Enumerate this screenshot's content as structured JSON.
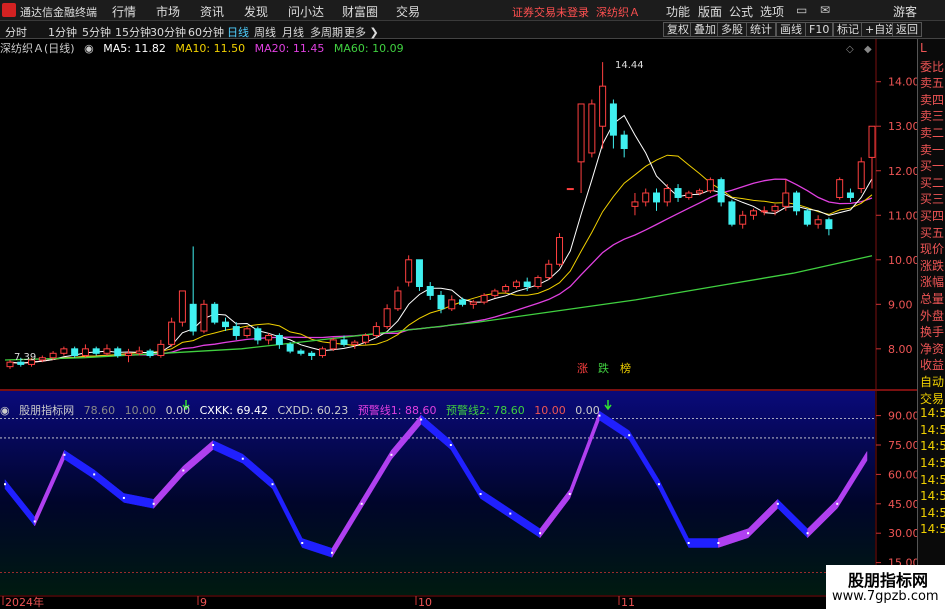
{
  "app_title": "通达信金融终端",
  "menu": [
    "行情",
    "市场",
    "资讯",
    "发现",
    "问小达",
    "财富圈",
    "交易"
  ],
  "account_status": "证券交易未登录",
  "stock_title": "深纺织Ａ",
  "right_menu": [
    "功能",
    "版面",
    "公式",
    "选项"
  ],
  "guest": "游客",
  "periods": [
    "分时",
    "1分钟",
    "5分钟",
    "15分钟",
    "30分钟",
    "60分钟",
    "日线",
    "周线",
    "月线",
    "多周期",
    "更多"
  ],
  "active_period": "日线",
  "tool_buttons": [
    "复权",
    "叠加",
    "多股",
    "统计",
    "画线",
    "F10",
    "标记",
    "+自选",
    "返回"
  ],
  "right_col": [
    "L",
    "委比",
    "卖五",
    "卖四",
    "卖三",
    "卖二",
    "卖一",
    "买一",
    "买二",
    "买三",
    "买四",
    "买五",
    "现价",
    "涨跌",
    "涨幅",
    "总量",
    "外盘",
    "换手",
    "净资",
    "收益",
    "自动",
    "交易",
    "14:56",
    "14:56",
    "14:56",
    "14:56",
    "14:56",
    "14:56",
    "14:56",
    "14:56"
  ],
  "chart_header": {
    "name": "深纺织Ａ(日线)",
    "ma5": "MA5: 11.82",
    "ma10": "MA10: 11.50",
    "ma20": "MA20: 11.45",
    "ma60": "MA60: 10.09",
    "ma5_color": "#ffffff",
    "ma10_color": "#f0d000",
    "ma20_color": "#e040e0",
    "ma60_color": "#40d040"
  },
  "ind_header": {
    "name": "股朋指标网",
    "v1": "78.60",
    "v2": "10.00",
    "v3": "0.00",
    "cxkk": "CXKK: 69.42",
    "cxdd": "CXDD: 60.23",
    "warn1": "预警线1: 88.60",
    "warn2": "预警线2: 78.60",
    "v4": "10.00",
    "v5": "0.00"
  },
  "price_labels": [
    "14.00",
    "13.00",
    "12.00",
    "11.00",
    "10.00",
    "9.00",
    "8.00"
  ],
  "ind_labels": [
    "90.00",
    "75.00",
    "60.00",
    "45.00",
    "30.00",
    "15.00"
  ],
  "high_label": "14.44",
  "low_label": "7.39",
  "signals": [
    "涨",
    "跌",
    "榜"
  ],
  "date_labels": [
    "2024年",
    "9",
    "10",
    "11"
  ],
  "watermark": {
    "line1": "股朋指标网",
    "line2": "www.7gpzb.com"
  },
  "chart_data": {
    "type": "candlestick",
    "y_range": [
      7.3,
      14.6
    ],
    "indicator_range": [
      0,
      100
    ],
    "candles": [
      [
        7.6,
        7.7,
        7.55,
        7.75
      ],
      [
        7.7,
        7.65,
        7.6,
        7.8
      ],
      [
        7.65,
        7.75,
        7.6,
        7.8
      ],
      [
        7.75,
        7.8,
        7.7,
        7.85
      ],
      [
        7.8,
        7.9,
        7.75,
        7.95
      ],
      [
        7.9,
        8.0,
        7.85,
        8.05
      ],
      [
        8.0,
        7.85,
        7.8,
        8.05
      ],
      [
        7.85,
        8.0,
        7.8,
        8.1
      ],
      [
        8.0,
        7.9,
        7.85,
        8.05
      ],
      [
        7.9,
        8.0,
        7.85,
        8.1
      ],
      [
        8.0,
        7.85,
        7.8,
        8.05
      ],
      [
        7.85,
        7.9,
        7.7,
        8.0
      ],
      [
        7.9,
        7.95,
        7.85,
        8.05
      ],
      [
        7.95,
        7.85,
        7.8,
        8.0
      ],
      [
        7.85,
        8.1,
        7.8,
        8.2
      ],
      [
        8.1,
        8.6,
        8.05,
        8.7
      ],
      [
        8.6,
        9.3,
        8.5,
        9.3
      ],
      [
        9.0,
        8.4,
        8.3,
        10.3
      ],
      [
        8.4,
        9.0,
        8.35,
        9.1
      ],
      [
        9.0,
        8.6,
        8.55,
        9.05
      ],
      [
        8.6,
        8.5,
        8.4,
        8.7
      ],
      [
        8.5,
        8.3,
        8.2,
        8.6
      ],
      [
        8.3,
        8.45,
        8.25,
        8.5
      ],
      [
        8.45,
        8.2,
        8.1,
        8.5
      ],
      [
        8.2,
        8.3,
        8.1,
        8.35
      ],
      [
        8.3,
        8.1,
        8.0,
        8.35
      ],
      [
        8.1,
        7.95,
        7.9,
        8.15
      ],
      [
        7.95,
        7.9,
        7.85,
        8.0
      ],
      [
        7.9,
        7.85,
        7.75,
        7.95
      ],
      [
        7.85,
        8.0,
        7.8,
        8.05
      ],
      [
        8.0,
        8.2,
        7.95,
        8.25
      ],
      [
        8.2,
        8.1,
        8.05,
        8.3
      ],
      [
        8.1,
        8.15,
        8.0,
        8.2
      ],
      [
        8.15,
        8.3,
        8.1,
        8.35
      ],
      [
        8.3,
        8.5,
        8.25,
        8.6
      ],
      [
        8.5,
        8.9,
        8.45,
        9.0
      ],
      [
        8.9,
        9.3,
        8.85,
        9.4
      ],
      [
        9.5,
        10.0,
        9.4,
        10.1
      ],
      [
        10.0,
        9.4,
        9.3,
        10.0
      ],
      [
        9.4,
        9.2,
        9.1,
        9.5
      ],
      [
        9.2,
        8.9,
        8.8,
        9.3
      ],
      [
        8.9,
        9.1,
        8.85,
        9.2
      ],
      [
        9.1,
        9.0,
        8.95,
        9.15
      ],
      [
        9.0,
        9.05,
        8.9,
        9.1
      ],
      [
        9.05,
        9.2,
        9.0,
        9.25
      ],
      [
        9.2,
        9.3,
        9.15,
        9.35
      ],
      [
        9.3,
        9.4,
        9.25,
        9.45
      ],
      [
        9.4,
        9.5,
        9.35,
        9.55
      ],
      [
        9.5,
        9.4,
        9.3,
        9.6
      ],
      [
        9.4,
        9.6,
        9.35,
        9.65
      ],
      [
        9.6,
        9.9,
        9.55,
        10.0
      ],
      [
        9.9,
        10.5,
        9.85,
        10.6
      ],
      [
        11.6,
        11.6,
        11.6,
        11.6
      ],
      [
        12.2,
        13.5,
        11.5,
        13.5
      ],
      [
        12.4,
        13.5,
        12.3,
        13.6
      ],
      [
        13.0,
        13.9,
        12.5,
        14.44
      ],
      [
        13.5,
        12.8,
        12.5,
        13.6
      ],
      [
        12.8,
        12.5,
        12.3,
        12.9
      ],
      [
        11.2,
        11.3,
        11.0,
        11.5
      ],
      [
        11.3,
        11.5,
        11.2,
        11.6
      ],
      [
        11.5,
        11.3,
        11.1,
        11.6
      ],
      [
        11.3,
        11.6,
        11.2,
        11.7
      ],
      [
        11.6,
        11.4,
        11.3,
        11.7
      ],
      [
        11.4,
        11.5,
        11.35,
        11.55
      ],
      [
        11.5,
        11.55,
        11.45,
        11.6
      ],
      [
        11.55,
        11.8,
        11.5,
        11.85
      ],
      [
        11.8,
        11.3,
        11.2,
        11.85
      ],
      [
        11.3,
        10.8,
        10.75,
        11.35
      ],
      [
        10.8,
        11.0,
        10.7,
        11.1
      ],
      [
        11.0,
        11.1,
        10.9,
        11.15
      ],
      [
        11.1,
        11.1,
        11.0,
        11.2
      ],
      [
        11.1,
        11.2,
        11.0,
        11.25
      ],
      [
        11.2,
        11.5,
        11.1,
        11.8
      ],
      [
        11.5,
        11.1,
        11.0,
        11.55
      ],
      [
        11.1,
        10.8,
        10.75,
        11.15
      ],
      [
        10.8,
        10.9,
        10.7,
        11.0
      ],
      [
        10.9,
        10.7,
        10.55,
        10.95
      ],
      [
        11.4,
        11.8,
        11.35,
        11.85
      ],
      [
        11.5,
        11.4,
        11.3,
        11.6
      ],
      [
        11.6,
        12.2,
        11.5,
        12.3
      ],
      [
        12.3,
        13.0,
        11.6,
        13.0
      ]
    ],
    "ma5_last": 11.82,
    "ma10_last": 11.5,
    "ma20_last": 11.45,
    "ma60_last": 10.09,
    "ma60": [
      7.75,
      7.8,
      7.9,
      8.0,
      8.2,
      8.4,
      8.6,
      8.85,
      9.1,
      9.4,
      9.7,
      10.09
    ],
    "cxkk": [
      55,
      36,
      70,
      60,
      48,
      45,
      62,
      75,
      68,
      55,
      25,
      20,
      45,
      70,
      88,
      75,
      50,
      40,
      30,
      50,
      90,
      80,
      55,
      25,
      25,
      30,
      45,
      30,
      45,
      69.4
    ],
    "warn1": 88.6,
    "warn2": 78.6
  }
}
